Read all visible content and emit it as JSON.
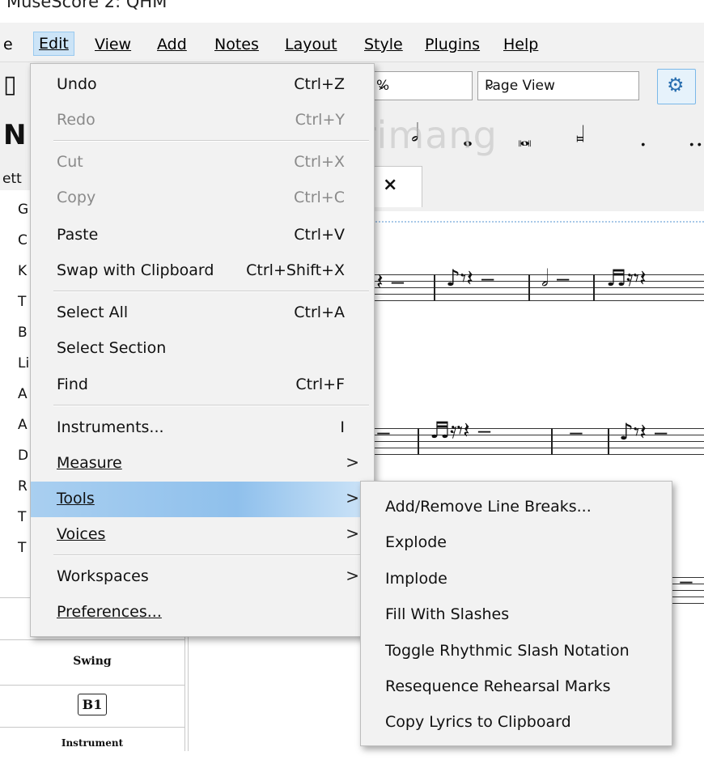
{
  "window": {
    "title": "MuseScore 2: QHM"
  },
  "menubar": {
    "items": [
      {
        "label": "e"
      },
      {
        "label": "Edit",
        "mnemonic": "E"
      },
      {
        "label": "View",
        "mnemonic": "V"
      },
      {
        "label": "Add",
        "mnemonic": "A"
      },
      {
        "label": "Notes",
        "mnemonic": "N"
      },
      {
        "label": "Layout",
        "mnemonic": "L"
      },
      {
        "label": "Style",
        "mnemonic": "S"
      },
      {
        "label": "Plugins",
        "mnemonic": "P"
      },
      {
        "label": "Help",
        "mnemonic": "H"
      }
    ]
  },
  "toolbar": {
    "zoom_value": "%",
    "view_mode": "Page View",
    "note_input_letter": "N",
    "playback_icon": "midi-connector-icon"
  },
  "watermark": "Quantrimang",
  "tabs": {
    "score_tab_close": "×"
  },
  "palette": {
    "header": "ett",
    "rows": [
      "G",
      "C",
      "K",
      "T",
      "B",
      "Li",
      "A",
      "A",
      "D",
      "R",
      "T",
      "T"
    ],
    "cells": [
      "Swing",
      "B1",
      "Instrument"
    ]
  },
  "edit_menu": {
    "items": [
      {
        "label": "Undo",
        "shortcut": "Ctrl+Z",
        "disabled": false
      },
      {
        "label": "Redo",
        "shortcut": "Ctrl+Y",
        "disabled": true
      },
      {
        "label": "Cut",
        "shortcut": "Ctrl+X",
        "disabled": true
      },
      {
        "label": "Copy",
        "shortcut": "Ctrl+C",
        "disabled": true
      },
      {
        "label": "Paste",
        "shortcut": "Ctrl+V",
        "disabled": false
      },
      {
        "label": "Swap with Clipboard",
        "shortcut": "Ctrl+Shift+X",
        "disabled": false
      },
      {
        "label": "Select All",
        "shortcut": "Ctrl+A",
        "disabled": false
      },
      {
        "label": "Select Section",
        "shortcut": "",
        "disabled": false
      },
      {
        "label": "Find",
        "shortcut": "Ctrl+F",
        "disabled": false
      },
      {
        "label": "Instruments...",
        "shortcut": "I",
        "disabled": false
      },
      {
        "label": "Measure",
        "shortcut": "",
        "submenu": true,
        "mnemonic": "M"
      },
      {
        "label": "Tools",
        "shortcut": "",
        "submenu": true,
        "highlighted": true,
        "mnemonic": "T"
      },
      {
        "label": "Voices",
        "shortcut": "",
        "submenu": true,
        "mnemonic": "V"
      },
      {
        "label": "Workspaces",
        "shortcut": "",
        "submenu": true,
        "mnemonic": "o"
      },
      {
        "label": "Preferences...",
        "shortcut": "",
        "mnemonic": "P"
      }
    ],
    "submenu_arrow": ">"
  },
  "tools_submenu": {
    "items": [
      "Add/Remove Line Breaks...",
      "Explode",
      "Implode",
      "Fill With Slashes",
      "Toggle Rhythmic Slash Notation",
      "Resequence Rehearsal Marks",
      "Copy Lyrics to Clipboard"
    ]
  },
  "colors": {
    "menu_bg": "#f2f2f2",
    "highlight": "#99c9ef",
    "disabled_text": "#8a8a8a"
  }
}
